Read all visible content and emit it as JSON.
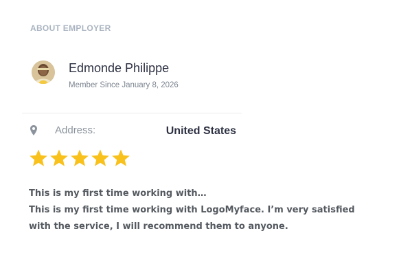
{
  "section": {
    "title": "ABOUT EMPLOYER"
  },
  "employer": {
    "name": "Edmonde Philippe",
    "member_since": "Member Since January 8, 2026",
    "avatar_icon": "user-avatar"
  },
  "address": {
    "icon": "map-pin-icon",
    "label": "Address:",
    "value": "United States"
  },
  "rating": {
    "stars": 5,
    "max": 5,
    "color": "#f8c11c"
  },
  "review": {
    "title": "This is my first time working with…",
    "body": "This is my first time working with LogoMyface. I’m very satisfied with the service, I will recommend them to anyone."
  },
  "colors": {
    "heading": "#2d3142",
    "muted": "#8b939c",
    "section_title": "#aab4c0",
    "star": "#f8c11c"
  }
}
